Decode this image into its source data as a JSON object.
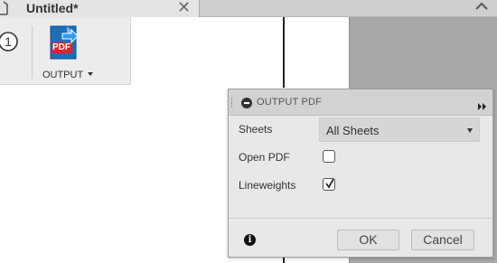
{
  "tab": {
    "title": "Untitled*",
    "close_glyph": "✕",
    "doc_icon": "document-icon",
    "collapse_icon": "chevron-up-icon"
  },
  "toolbar": {
    "step_icon": "step-1-icon",
    "output_label": "OUTPUT",
    "output_icon": "pdf-export-icon",
    "pdf_icon_text": "PDF"
  },
  "panel": {
    "title": "OUTPUT PDF",
    "collapse_icon": "minus-circle-icon",
    "expand_icon": "double-chevron-right-icon",
    "sheets_label": "Sheets",
    "sheets_value": "All Sheets",
    "open_pdf_label": "Open PDF",
    "open_pdf_checked": false,
    "lineweights_label": "Lineweights",
    "lineweights_checked": true,
    "info_glyph": "i",
    "ok_label": "OK",
    "cancel_label": "Cancel"
  },
  "colors": {
    "pdf_blue": "#1b6fb8",
    "pdf_red": "#d9262b",
    "canvas_grey": "#a8a8a8"
  }
}
